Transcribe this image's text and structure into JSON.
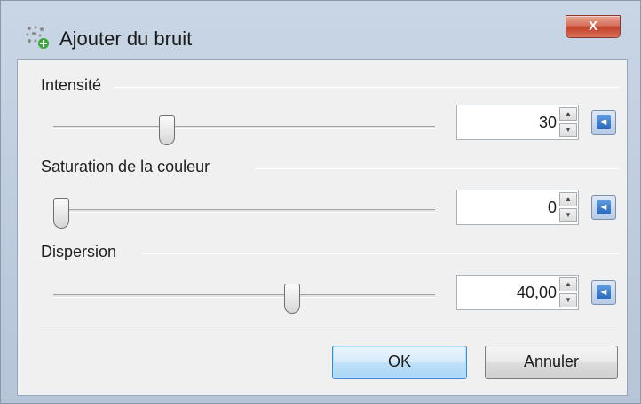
{
  "window": {
    "title": "Ajouter du bruit",
    "icon": "noise-dots-icon",
    "close_label": "X"
  },
  "groups": [
    {
      "label": "Intensité",
      "value": "30",
      "slider_fraction": 0.29
    },
    {
      "label": "Saturation de la couleur",
      "value": "0",
      "slider_fraction": 0.0
    },
    {
      "label": "Dispersion",
      "value": "40,00",
      "slider_fraction": 0.63
    }
  ],
  "buttons": {
    "ok": "OK",
    "cancel": "Annuler"
  },
  "colors": {
    "ok_border": "#3c8bd6",
    "reset_blue": "#2a66b8"
  }
}
